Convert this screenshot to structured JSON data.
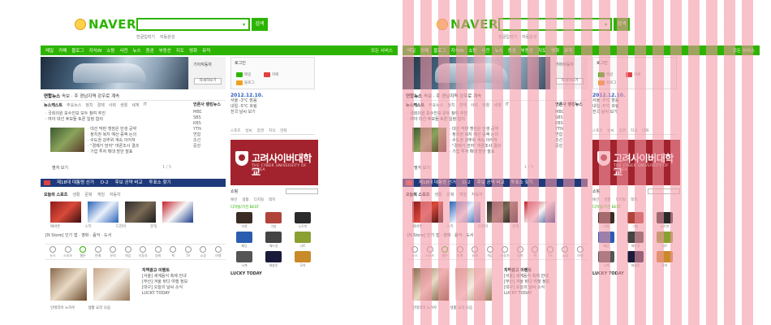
{
  "logo": {
    "text": "NAVER"
  },
  "search": {
    "button_label": "검색",
    "links": [
      "한글입력기",
      "자동완성"
    ]
  },
  "nav": {
    "items": [
      "메일",
      "카페",
      "블로그",
      "지식iN",
      "쇼핑",
      "사전",
      "뉴스",
      "증권",
      "부동산",
      "지도",
      "영화",
      "뮤직",
      "책",
      "웹툰"
    ],
    "right": "모든 서비스"
  },
  "banner": {
    "side_title": "기아자동차",
    "side_button": "자세히보기"
  },
  "newsbar": {
    "label": "연합뉴스",
    "text": "속보 · 주 경남지역 강우로 계속"
  },
  "news_tabs": [
    "뉴스캐스트",
    "주요뉴스",
    "정치",
    "경제",
    "사회",
    "생활",
    "세계",
    "IT"
  ],
  "news_list": [
    "· 국회의원 보수진보 모두 참여 추진",
    "· 여야 대선 후보들 토론 일정 합의"
  ],
  "news_text": [
    "· 대선 막판 쟁점은 민생 공약",
    "· 정치권 복지 예산 증액 논의",
    "· 수도권 강추위 계속 이어져",
    "· \"경제가 먼저\" 여론조사 결과",
    "· 기업 투자 확대 방안 발표"
  ],
  "news_more": "펼쳐 보기",
  "news_pager": "1 / 5",
  "ranking": {
    "title": "언론사 랭킹뉴스",
    "items": [
      "MBC",
      "SBS",
      "KBS",
      "YTN",
      "연합",
      "조선",
      "중앙"
    ]
  },
  "blue_bar": {
    "items": [
      "제18대 대통령 선거",
      "D-2",
      "후보 공약 비교",
      "투표소 찾기",
      "선거 속보"
    ]
  },
  "theme": {
    "tabs": [
      "오늘의 스포츠",
      "생활",
      "문화",
      "게임",
      "자동차"
    ],
    "captions": [
      "에버튼",
      "스키",
      "드라마",
      "뮤직"
    ],
    "store_line": "[N Store] 인기 앱 · 영화 · 음악 · 도서"
  },
  "icons": [
    {
      "name": "news",
      "label": "뉴스"
    },
    {
      "name": "sports",
      "label": "스포츠"
    },
    {
      "name": "webtoon",
      "label": "웹툰"
    },
    {
      "name": "entertain",
      "label": "연예"
    },
    {
      "name": "music",
      "label": "뮤직"
    },
    {
      "name": "game",
      "label": "게임"
    },
    {
      "name": "car",
      "label": "자동차"
    },
    {
      "name": "movie",
      "label": "영화"
    },
    {
      "name": "book",
      "label": "책"
    },
    {
      "name": "tv",
      "label": "TV"
    },
    {
      "name": "shop",
      "label": "쇼핑"
    },
    {
      "name": "travel",
      "label": "여행"
    }
  ],
  "bottom": {
    "captions": [
      "인테리어 노하우",
      "생활 요리 모음"
    ],
    "title": "지역광고 이벤트",
    "lines": [
      "[서울] 세계음식 축제 안내",
      "[부산] 겨울 바다 여행 정보",
      "[대구] 오늘의 날씨 소식",
      "LUCKY TODAY"
    ]
  },
  "login": {
    "title": "로그인",
    "rows": [
      "메일",
      "카페",
      "블로그"
    ]
  },
  "date_block": {
    "date": "2012.12.10.",
    "lines": [
      "서울 -3°C 맑음",
      "내일 -5°C 흐림",
      "전국 날씨 보기"
    ]
  },
  "weather_tabs": [
    "스포츠",
    "날씨",
    "증권",
    "지식",
    "만화"
  ],
  "ad": {
    "title": "고려사이버대학교",
    "subtitle": "THE CYBER UNIVERSITY OF KOREA"
  },
  "shop": {
    "title": "쇼핑",
    "tabs": [
      "패션",
      "생활",
      "디지털",
      "레저"
    ],
    "sub": "디지털/가전 BEST",
    "products": [
      "자켓",
      "가방",
      "노트북",
      "패딩",
      "헤드셋",
      "니트",
      "시계",
      "태블릿",
      "모자"
    ],
    "footer": "LUCKY TODAY"
  },
  "colors": {
    "green": "#2db400",
    "navy": "#1f3a7a",
    "ad_red": "#a2232d",
    "stripe": "#f496a5"
  }
}
